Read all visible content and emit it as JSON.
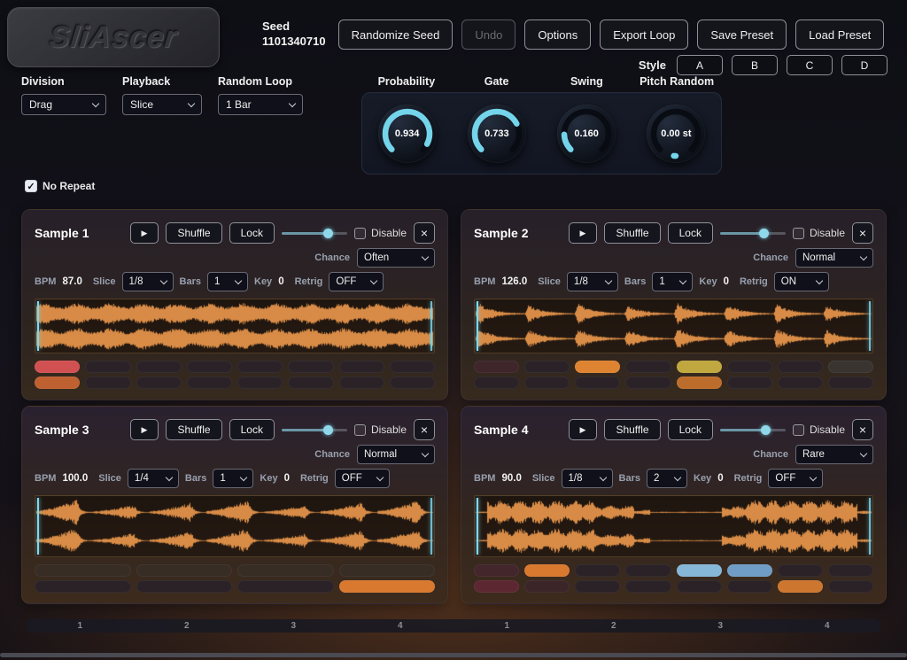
{
  "colors": {
    "accent": "#74d4ea",
    "waveform": "#e8964b",
    "pad_default": "#2a2226",
    "pad_default_alt": "#372d25"
  },
  "logo": {
    "text": "SliAscer"
  },
  "topbar": {
    "seed": {
      "label": "Seed",
      "value": "1101340710"
    },
    "randomize": "Randomize Seed",
    "undo": "Undo",
    "options": "Options",
    "export": "Export Loop",
    "save": "Save Preset",
    "load": "Load Preset",
    "style": {
      "label": "Style",
      "options": [
        "A",
        "B",
        "C",
        "D"
      ]
    }
  },
  "globals": {
    "division": {
      "label": "Division",
      "value": "Drag"
    },
    "playback": {
      "label": "Playback",
      "value": "Slice"
    },
    "random_loop": {
      "label": "Random Loop",
      "value": "1 Bar"
    },
    "no_repeat": {
      "label": "No Repeat",
      "checked": true
    }
  },
  "knobs": [
    {
      "label": "Probability",
      "value": 0.934,
      "display": "0.934"
    },
    {
      "label": "Gate",
      "value": 0.733,
      "display": "0.733"
    },
    {
      "label": "Swing",
      "value": 0.16,
      "display": "0.160"
    },
    {
      "label": "Pitch Random",
      "value": 0.0,
      "display": "0.00 st"
    }
  ],
  "sample_ui": {
    "play": "▶",
    "shuffle": "Shuffle",
    "lock": "Lock",
    "disable": "Disable",
    "close": "×",
    "chance_label": "Chance",
    "bpm_label": "BPM",
    "slice_label": "Slice",
    "bars_label": "Bars",
    "key_label": "Key",
    "retrig_label": "Retrig"
  },
  "samples": [
    {
      "title": "Sample 1",
      "chance": "Often",
      "bpm": "87.0",
      "slice": "1/8",
      "bars": "1",
      "key": "0",
      "retrig": "OFF",
      "slider": 0.72,
      "disable_checked": false,
      "wave": {
        "pattern": "dense",
        "seed": 11
      },
      "pads": {
        "cols": 8,
        "rows": [
          [
            "#d15153",
            "d",
            "d",
            "d",
            "d",
            "d",
            "d",
            "d"
          ],
          [
            "#bf6031",
            "d",
            "d",
            "d",
            "d",
            "d",
            "d",
            "d"
          ]
        ]
      }
    },
    {
      "title": "Sample 2",
      "chance": "Normal",
      "bpm": "126.0",
      "slice": "1/8",
      "bars": "1",
      "key": "0",
      "retrig": "ON",
      "slider": 0.68,
      "disable_checked": false,
      "wave": {
        "pattern": "beats",
        "seed": 22
      },
      "pads": {
        "cols": 8,
        "rows": [
          [
            "#3e262b",
            "d",
            "#de8331",
            "d",
            "#c0a73f",
            "d",
            "d",
            "#3a3430"
          ],
          [
            "d",
            "d",
            "d",
            "d",
            "#bd6d2b",
            "d",
            "d",
            "d"
          ]
        ]
      }
    },
    {
      "title": "Sample 3",
      "chance": "Normal",
      "bpm": "100.0",
      "slice": "1/4",
      "bars": "1",
      "key": "0",
      "retrig": "OFF",
      "slider": 0.72,
      "disable_checked": false,
      "wave": {
        "pattern": "hits",
        "seed": 33
      },
      "pads": {
        "cols": 4,
        "rows": [
          [
            "a",
            "a",
            "a",
            "a"
          ],
          [
            "d",
            "d",
            "d",
            "#d9782f"
          ]
        ]
      }
    },
    {
      "title": "Sample 4",
      "chance": "Rare",
      "bpm": "90.0",
      "slice": "1/8",
      "bars": "2",
      "key": "0",
      "retrig": "OFF",
      "slider": 0.7,
      "disable_checked": false,
      "wave": {
        "pattern": "vocal",
        "seed": 44
      },
      "pads": {
        "cols": 8,
        "rows": [
          [
            "#43262b",
            "#d9782f",
            "d",
            "d",
            "#86b7d7",
            "#6f9dc5",
            "d",
            "d"
          ],
          [
            "#5d2731",
            "#3b2529",
            "d",
            "d",
            "d",
            "d",
            "#cc762f",
            "d"
          ]
        ]
      }
    }
  ],
  "timeline": {
    "beats": [
      "1",
      "2",
      "3",
      "4",
      "1",
      "2",
      "3",
      "4"
    ]
  }
}
